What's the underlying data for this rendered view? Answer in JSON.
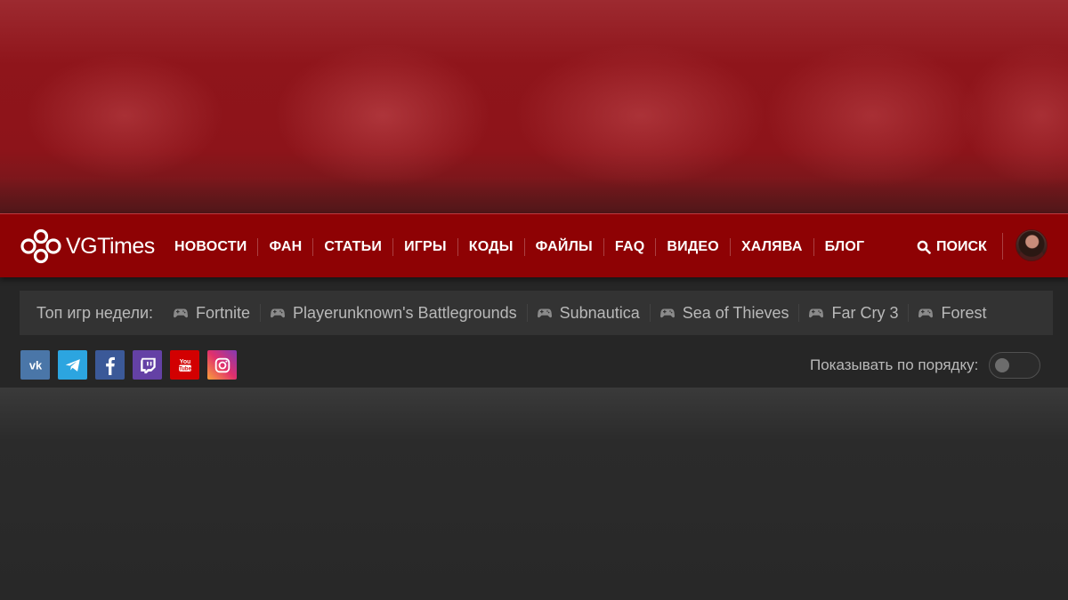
{
  "banner": {},
  "brand": {
    "logo_text": "VGTimes",
    "logo_icon": "vgtimes-logo-mark"
  },
  "nav": {
    "items": [
      {
        "label": "НОВОСТИ"
      },
      {
        "label": "ФАН"
      },
      {
        "label": "СТАТЬИ"
      },
      {
        "label": "ИГРЫ"
      },
      {
        "label": "КОДЫ"
      },
      {
        "label": "ФАЙЛЫ"
      },
      {
        "label": "FAQ"
      },
      {
        "label": "ВИДЕО"
      },
      {
        "label": "ХАЛЯВА"
      },
      {
        "label": "БЛОГ"
      }
    ],
    "search_label": "ПОИСК",
    "search_icon": "search-icon",
    "avatar": "user-avatar"
  },
  "top_games": {
    "label": "Топ игр недели:",
    "icon": "gamepad-icon",
    "games": [
      {
        "name": "Fortnite"
      },
      {
        "name": "Playerunknown's Battlegrounds"
      },
      {
        "name": "Subnautica"
      },
      {
        "name": "Sea of Thieves"
      },
      {
        "name": "Far Cry 3"
      },
      {
        "name": "Forest"
      }
    ]
  },
  "socials": [
    {
      "icon": "vk-icon",
      "color": "#4a76a8"
    },
    {
      "icon": "telegram-icon",
      "color": "#2ca5e0"
    },
    {
      "icon": "facebook-icon",
      "color": "#3b5998"
    },
    {
      "icon": "twitch-icon",
      "color": "#6441a5"
    },
    {
      "icon": "youtube-icon",
      "color": "#d20001"
    },
    {
      "icon": "instagram-icon",
      "color": "#c13584"
    }
  ],
  "order": {
    "label": "Показывать по порядку:",
    "toggle_on": false
  },
  "colors": {
    "nav_bg": "#8e0204",
    "page_bg": "#262626",
    "bar_bg": "#333333",
    "text_muted": "#b9b9b9"
  }
}
